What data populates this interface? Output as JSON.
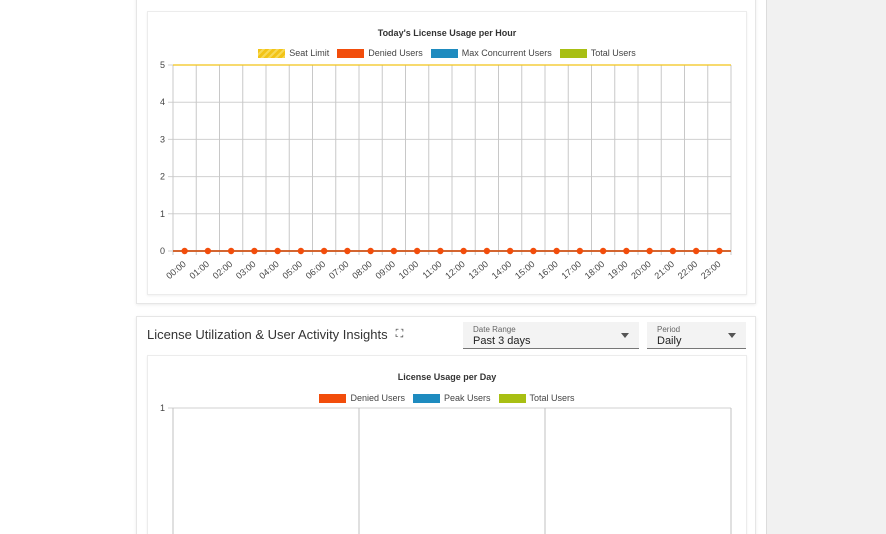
{
  "hourly_chart": {
    "title": "Today's License Usage per Hour",
    "legend": [
      {
        "label": "Seat Limit",
        "color": "#f2c418"
      },
      {
        "label": "Denied Users",
        "color": "#f24d0b"
      },
      {
        "label": "Max Concurrent Users",
        "color": "#1e8bbf"
      },
      {
        "label": "Total Users",
        "color": "#a8bf13"
      }
    ]
  },
  "insights": {
    "title": "License Utilization & User Activity Insights",
    "date_range": {
      "label": "Date Range",
      "value": "Past 3 days"
    },
    "period": {
      "label": "Period",
      "value": "Daily"
    }
  },
  "daily_chart": {
    "title": "License Usage per Day",
    "legend": [
      {
        "label": "Denied Users",
        "color": "#f24d0b"
      },
      {
        "label": "Peak Users",
        "color": "#1e8bbf"
      },
      {
        "label": "Total Users",
        "color": "#a8bf13"
      }
    ]
  },
  "chart_data": [
    {
      "type": "line",
      "title": "Today's License Usage per Hour",
      "categories": [
        "00:00",
        "01:00",
        "02:00",
        "03:00",
        "04:00",
        "05:00",
        "06:00",
        "07:00",
        "08:00",
        "09:00",
        "10:00",
        "11:00",
        "12:00",
        "13:00",
        "14:00",
        "15:00",
        "16:00",
        "17:00",
        "18:00",
        "19:00",
        "20:00",
        "21:00",
        "22:00",
        "23:00"
      ],
      "yticks": [
        "0",
        "1",
        "2",
        "3",
        "4",
        "5"
      ],
      "ylim": [
        0,
        5
      ],
      "grid": true,
      "legend_position": "top",
      "series": [
        {
          "name": "Seat Limit",
          "color": "#f2c418",
          "values": [
            5,
            5,
            5,
            5,
            5,
            5,
            5,
            5,
            5,
            5,
            5,
            5,
            5,
            5,
            5,
            5,
            5,
            5,
            5,
            5,
            5,
            5,
            5,
            5
          ]
        },
        {
          "name": "Denied Users",
          "color": "#f24d0b",
          "values": [
            0,
            0,
            0,
            0,
            0,
            0,
            0,
            0,
            0,
            0,
            0,
            0,
            0,
            0,
            0,
            0,
            0,
            0,
            0,
            0,
            0,
            0,
            0,
            0
          ]
        },
        {
          "name": "Max Concurrent Users",
          "color": "#1e8bbf",
          "values": [
            0,
            0,
            0,
            0,
            0,
            0,
            0,
            0,
            0,
            0,
            0,
            0,
            0,
            0,
            0,
            0,
            0,
            0,
            0,
            0,
            0,
            0,
            0,
            0
          ]
        },
        {
          "name": "Total Users",
          "color": "#a8bf13",
          "values": [
            0,
            0,
            0,
            0,
            0,
            0,
            0,
            0,
            0,
            0,
            0,
            0,
            0,
            0,
            0,
            0,
            0,
            0,
            0,
            0,
            0,
            0,
            0,
            0
          ]
        }
      ]
    },
    {
      "type": "line",
      "title": "License Usage per Day",
      "yticks": [
        "1"
      ],
      "grid": true,
      "legend_position": "top",
      "series": [
        {
          "name": "Denied Users",
          "color": "#f24d0b",
          "values": []
        },
        {
          "name": "Peak Users",
          "color": "#1e8bbf",
          "values": []
        },
        {
          "name": "Total Users",
          "color": "#a8bf13",
          "values": []
        }
      ]
    }
  ]
}
